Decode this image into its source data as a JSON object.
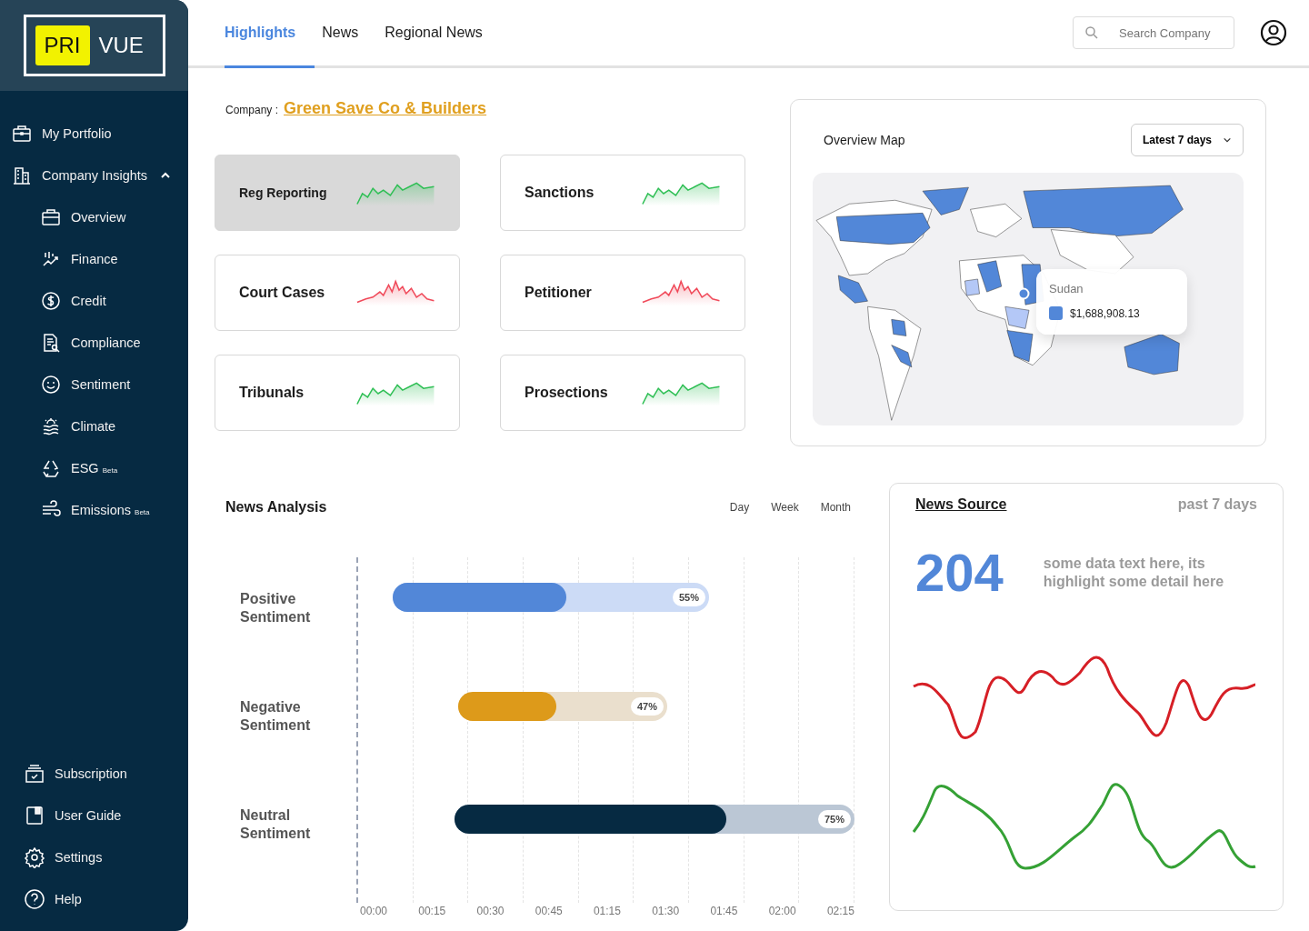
{
  "sidebar": {
    "logo": {
      "highlight": "PRI",
      "rest": "VUE"
    },
    "items": [
      {
        "label": "My Portfolio"
      },
      {
        "label": "Company Insights",
        "expanded": true,
        "children": [
          {
            "label": "Overview"
          },
          {
            "label": "Finance"
          },
          {
            "label": "Credit"
          },
          {
            "label": "Compliance"
          },
          {
            "label": "Sentiment"
          },
          {
            "label": "Climate"
          },
          {
            "label": "ESG",
            "badge": "Beta"
          },
          {
            "label": "Emissions",
            "badge": "Beta"
          }
        ]
      }
    ],
    "footer_items": [
      {
        "label": "Subscription"
      },
      {
        "label": "User Guide"
      },
      {
        "label": "Settings"
      },
      {
        "label": "Help"
      }
    ]
  },
  "tabs": [
    {
      "label": "Highlights",
      "selected": true
    },
    {
      "label": "News",
      "selected": false
    },
    {
      "label": "Regional News",
      "selected": false
    }
  ],
  "search": {
    "placeholder": "Search Company"
  },
  "company": {
    "label": "Company :",
    "name": "Green Save Co & Builders"
  },
  "cards": [
    {
      "title": "Reg Reporting",
      "selected": true,
      "color": "#2fbf55"
    },
    {
      "title": "Sanctions",
      "selected": false,
      "color": "#2fbf55"
    },
    {
      "title": "Court Cases",
      "selected": false,
      "color": "#f04a5a"
    },
    {
      "title": "Petitioner",
      "selected": false,
      "color": "#f04a5a"
    },
    {
      "title": "Tribunals",
      "selected": false,
      "color": "#2fbf55"
    },
    {
      "title": "Prosections",
      "selected": false,
      "color": "#2fbf55"
    }
  ],
  "map": {
    "title": "Overview Map",
    "range": "Latest 7 days",
    "tooltip": {
      "country": "Sudan",
      "value": "$1,688,908.13",
      "color": "#5287d8"
    }
  },
  "news_analysis": {
    "title": "News Analysis",
    "periods": [
      "Day",
      "Week",
      "Month"
    ],
    "sentiments": [
      {
        "label": "Positive Sentiment",
        "level": 0.55,
        "reading": "55%",
        "color": "#5287d8"
      },
      {
        "label": "Negative Sentiment",
        "level": 0.47,
        "reading": "47%",
        "color": "#dd9a1a"
      },
      {
        "label": "Neutral Sentiment",
        "level": 0.68,
        "reading": "75%",
        "color": "#062a42"
      }
    ],
    "time_ticks": [
      "00:00",
      "00:15",
      "00:30",
      "00:45",
      "01:15",
      "01:30",
      "01:45",
      "02:00",
      "02:15"
    ]
  },
  "news_source": {
    "title": "News Source",
    "range": "past 7 days",
    "count": "204",
    "description": "some data text here, its highlight some detail here"
  }
}
